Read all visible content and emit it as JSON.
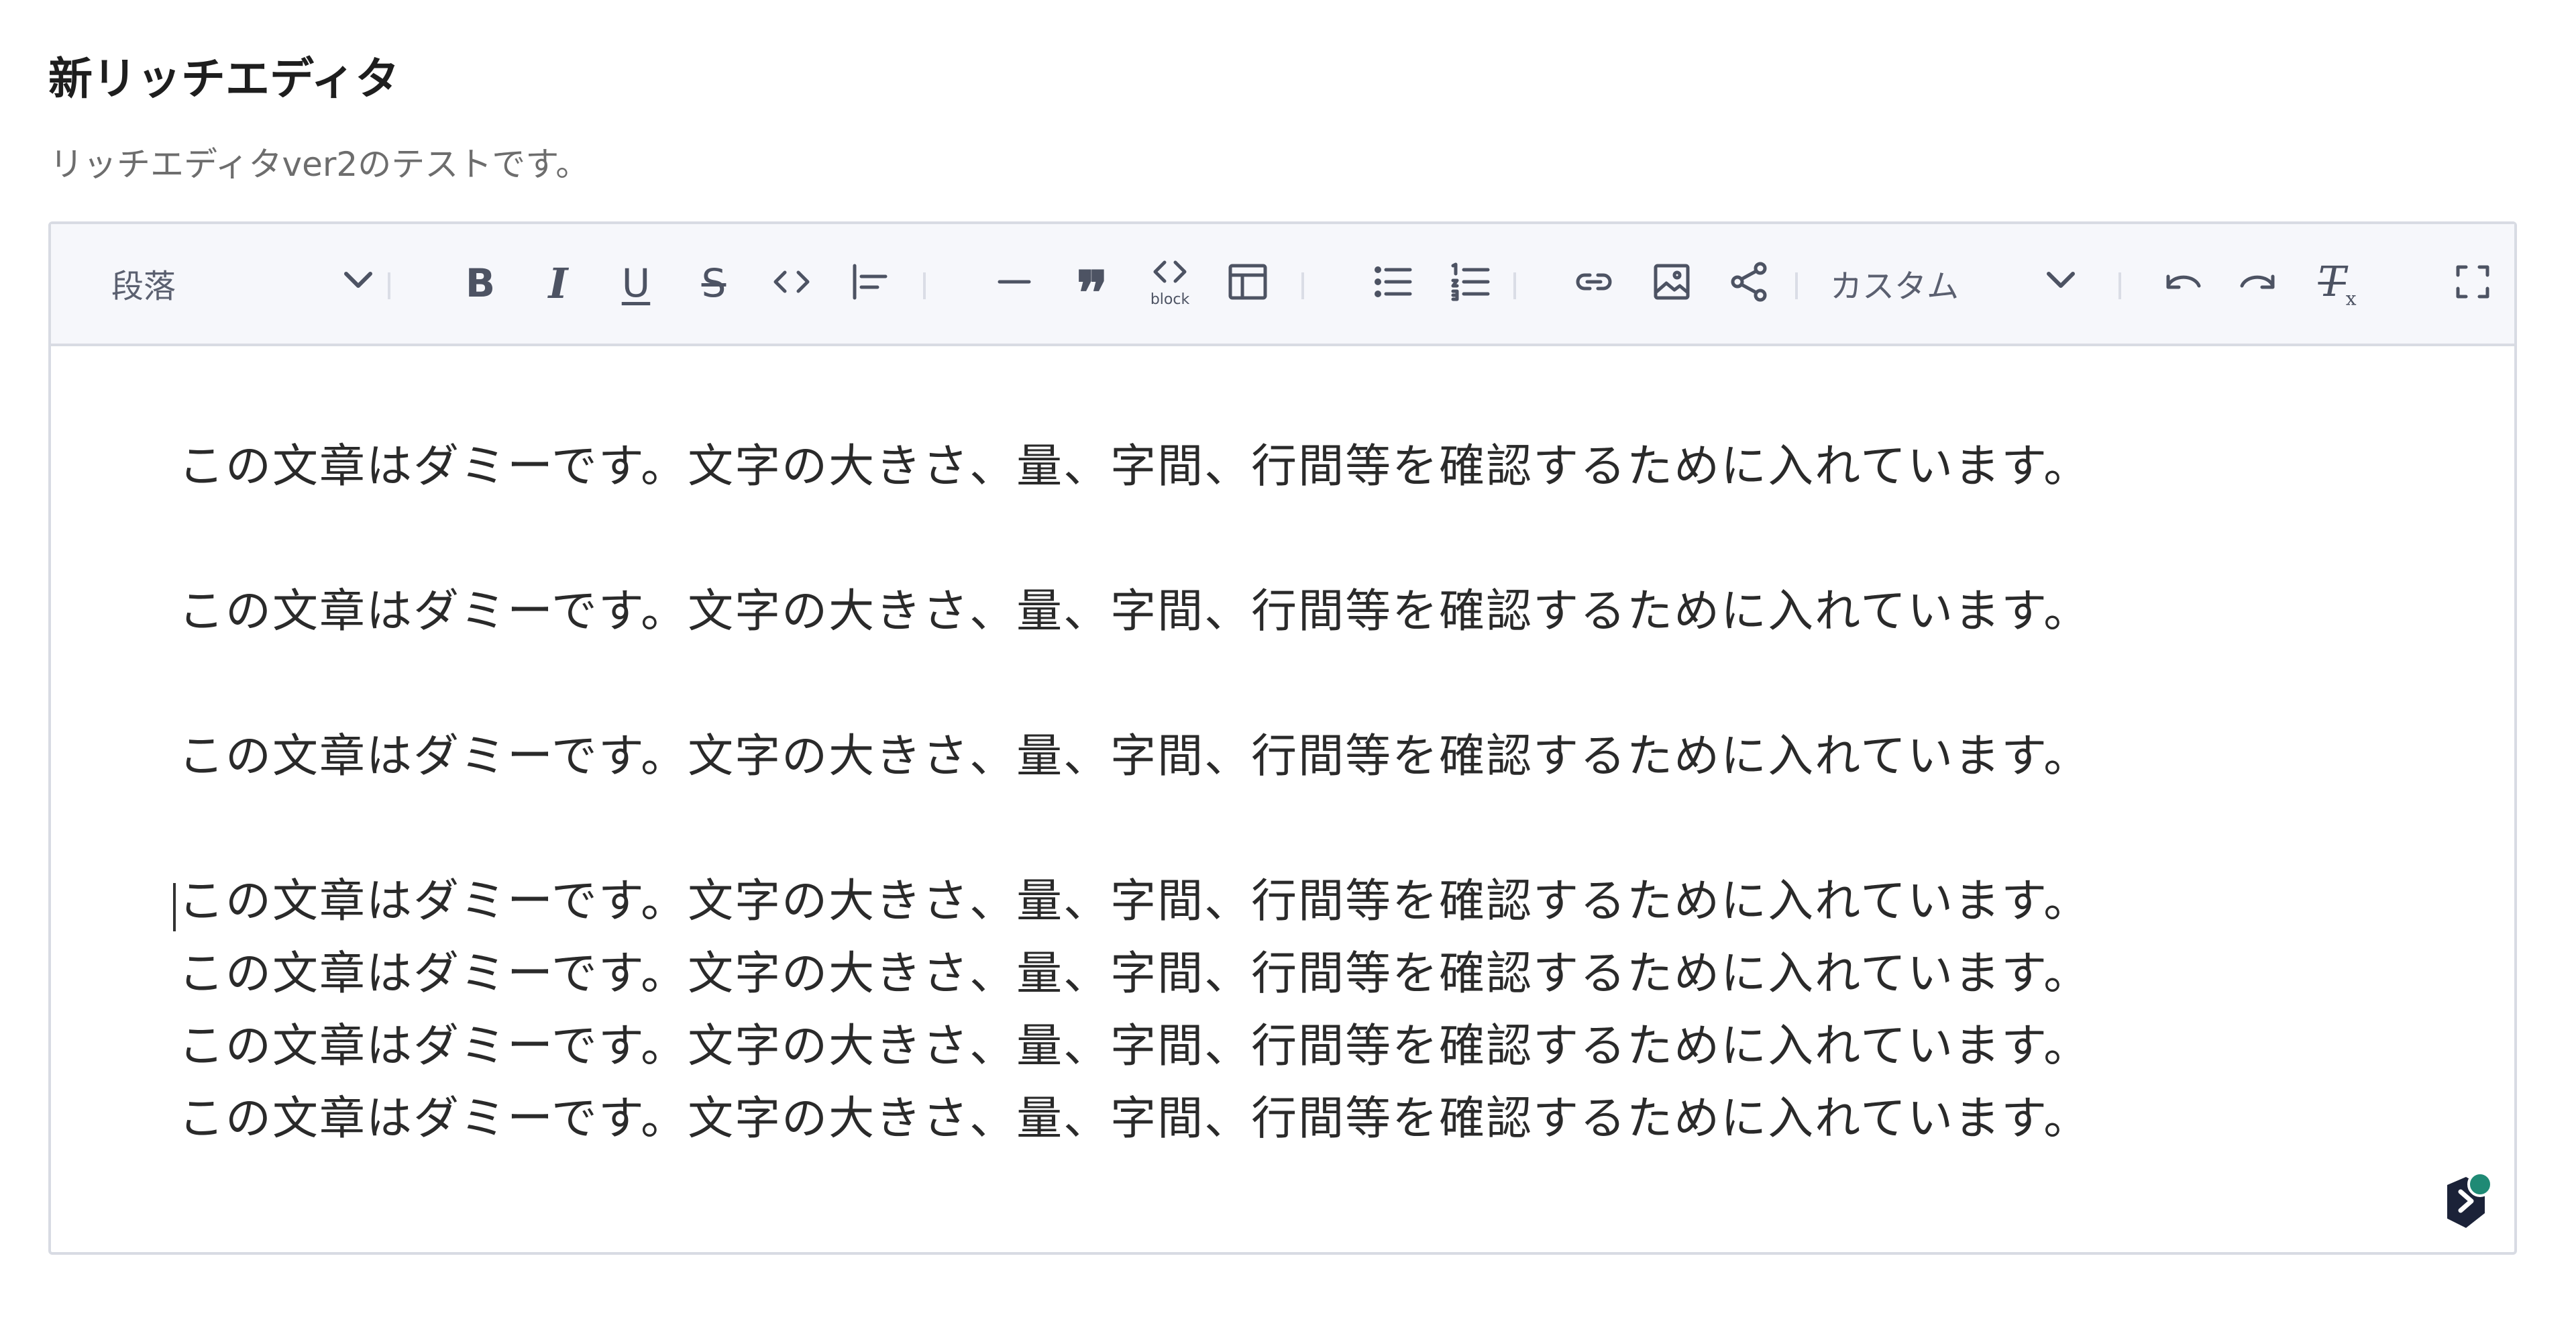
{
  "field": {
    "title": "新リッチエディタ",
    "description": "リッチエディタver2のテストです。"
  },
  "toolbar": {
    "block_format_value": "段落",
    "bold_label": "B",
    "italic_label": "I",
    "underline_label": "U",
    "strike_label": "S",
    "quote_label": "❞",
    "code_block_label": "block",
    "custom_select_value": "カスタム",
    "clear_format_label": "T",
    "clear_format_sub": "x"
  },
  "content": {
    "paragraphs": [
      "この文章はダミーです。文字の大きさ、量、字間、行間等を確認するために入れています。",
      "この文章はダミーです。文字の大きさ、量、字間、行間等を確認するために入れています。",
      "この文章はダミーです。文字の大きさ、量、字間、行間等を確認するために入れています。",
      "この文章はダミーです。文字の大きさ、量、字間、行間等を確認するために入れています。",
      "この文章はダミーです。文字の大きさ、量、字間、行間等を確認するために入れています。",
      "この文章はダミーです。文字の大きさ、量、字間、行間等を確認するために入れています。",
      "この文章はダミーです。文字の大きさ、量、字間、行間等を確認するために入れています。"
    ]
  },
  "colors": {
    "toolbar_bg": "#f6f7fb",
    "border": "#d8dbe3",
    "icon": "#4d5363",
    "text": "#2a2a2a",
    "badge": "#1f8a75"
  },
  "icons": [
    "chevron-down-icon",
    "bold-icon",
    "italic-icon",
    "underline-icon",
    "strikethrough-icon",
    "inline-code-icon",
    "align-left-icon",
    "horizontal-rule-icon",
    "quote-icon",
    "code-block-icon",
    "table-icon",
    "bulleted-list-icon",
    "numbered-list-icon",
    "link-icon",
    "image-icon",
    "share-icon",
    "undo-icon",
    "redo-icon",
    "clear-format-icon",
    "fullscreen-icon",
    "assistant-icon"
  ]
}
